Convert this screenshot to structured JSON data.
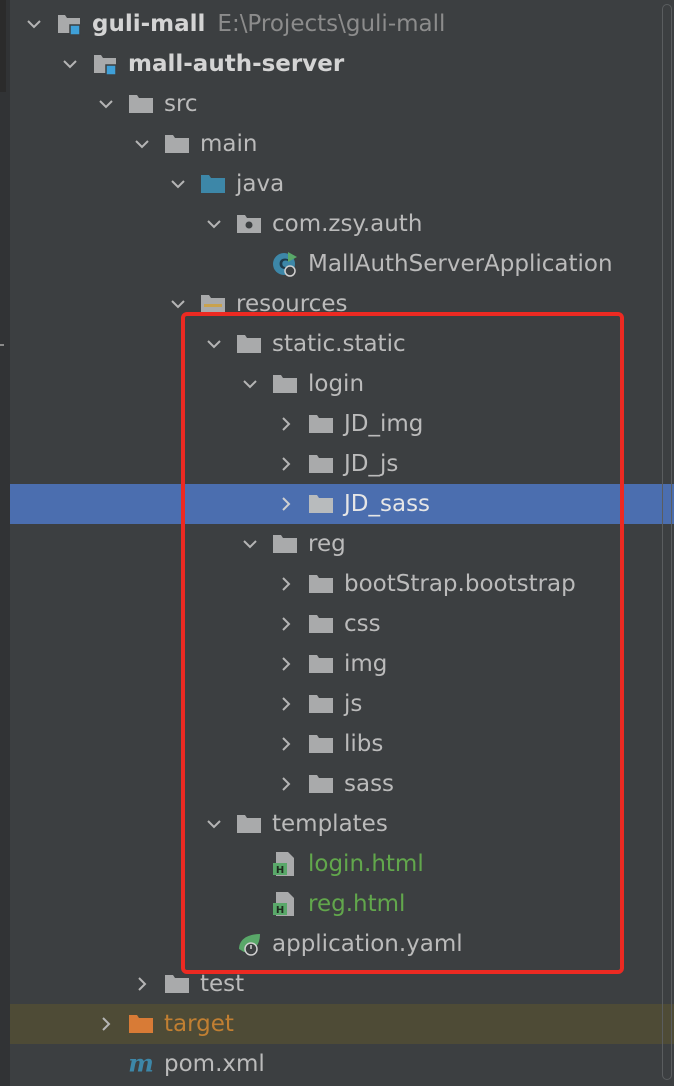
{
  "tree": {
    "root": {
      "name": "guli-mall",
      "path": "E:\\Projects\\guli-mall"
    },
    "module": {
      "name": "mall-auth-server"
    },
    "src": "src",
    "main": "main",
    "java": "java",
    "package": "com.zsy.auth",
    "app_class": "MallAuthServerApplication",
    "resources": "resources",
    "static_dir": "static.static",
    "login_dir": "login",
    "login_children": [
      "JD_img",
      "JD_js",
      "JD_sass"
    ],
    "reg_dir": "reg",
    "reg_children": [
      "bootStrap.bootstrap",
      "css",
      "img",
      "js",
      "libs",
      "sass"
    ],
    "templates_dir": "templates",
    "templates_files": [
      "login.html",
      "reg.html"
    ],
    "config_file": "application.yaml",
    "test": "test",
    "target": "target",
    "pom": "pom.xml"
  },
  "selected_item": "JD_sass",
  "colors": {
    "background": "#3c3f41",
    "selection": "#4b6eaf",
    "highlight_box": "#ec2a22",
    "vcs_added_green": "#62a74c",
    "excluded_orange": "#c17f32"
  },
  "icons": {
    "folder": "folder-icon",
    "module": "module-icon",
    "source_root": "source-folder-icon",
    "package": "package-icon",
    "spring_boot_app": "spring-boot-class-icon",
    "resources_root": "resources-folder-icon",
    "html": "html-file-icon",
    "yaml": "spring-yaml-icon",
    "excluded": "excluded-folder-icon",
    "maven": "maven-icon"
  }
}
